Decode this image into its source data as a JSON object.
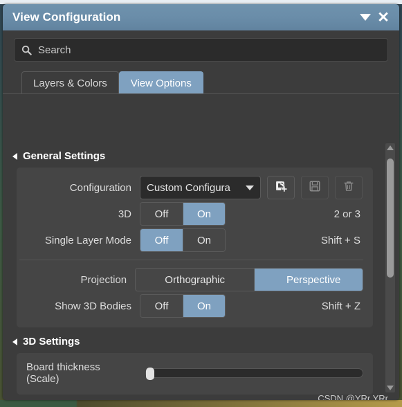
{
  "window": {
    "title": "View Configuration",
    "collapse_icon": "chevron-down-icon",
    "close_icon": "close-icon"
  },
  "search": {
    "placeholder": "Search",
    "value": "",
    "icon": "search-icon"
  },
  "tabs": [
    {
      "label": "Layers & Colors",
      "active": false
    },
    {
      "label": "View Options",
      "active": true
    }
  ],
  "sections": [
    {
      "title": "General Settings",
      "expanded": true
    },
    {
      "title": "3D Settings",
      "expanded": true
    }
  ],
  "general_settings": {
    "configuration": {
      "label": "Configuration",
      "value": "Custom Configura",
      "arrow_icon": "chevron-down-icon",
      "buttons": [
        {
          "name": "save-as-new-configuration-button",
          "icon": "new-config-icon",
          "enabled": true
        },
        {
          "name": "save-configuration-button",
          "icon": "save-disk-icon",
          "enabled": false
        },
        {
          "name": "delete-configuration-button",
          "icon": "trash-icon",
          "enabled": false
        }
      ]
    },
    "three_d": {
      "label": "3D",
      "options": [
        "Off",
        "On"
      ],
      "selected": "On",
      "shortcut": "2 or 3"
    },
    "single_layer_mode": {
      "label": "Single Layer Mode",
      "options": [
        "Off",
        "On"
      ],
      "selected": "Off",
      "shortcut": "Shift + S"
    },
    "projection": {
      "label": "Projection",
      "options": [
        "Orthographic",
        "Perspective"
      ],
      "selected": "Perspective",
      "shortcut": ""
    },
    "show_3d_bodies": {
      "label": "Show 3D Bodies",
      "options": [
        "Off",
        "On"
      ],
      "selected": "On",
      "shortcut": "Shift + Z"
    }
  },
  "three_d_settings": {
    "board_thickness": {
      "label": "Board thickness (Scale)",
      "value_percent": 0
    }
  },
  "scrollbar": {
    "up_icon": "triangle-up-icon",
    "down_icon": "triangle-down-icon"
  },
  "watermark": "CSDN @YRr YRr",
  "colors": {
    "accent": "#7fa1c0",
    "titlebar": "#6a8da9",
    "panel_bg": "#3c3c3c",
    "group_bg": "#454545",
    "field_bg": "#2b2b2b",
    "text": "#dcdcdc"
  }
}
